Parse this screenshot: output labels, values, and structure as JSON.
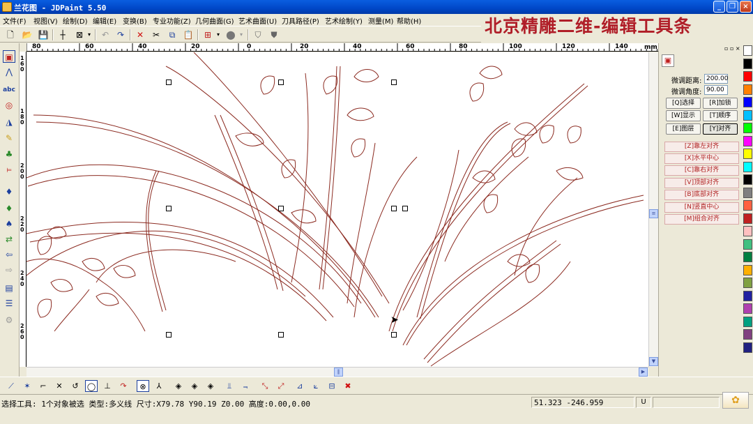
{
  "window": {
    "title": "兰花图 - JDPaint 5.50",
    "buttons": [
      "_",
      "❐",
      "×"
    ]
  },
  "banner": "北京精雕二维-编辑工具条",
  "menu": [
    "文件(F)",
    "视图(V)",
    "绘制(D)",
    "编辑(E)",
    "变换(B)",
    "专业功能(Z)",
    "几何曲面(G)",
    "艺术曲面(U)",
    "刀具路径(P)",
    "艺术绘制(Y)",
    "测量(M)",
    "帮助(H)"
  ],
  "ruler": {
    "unit": "mm",
    "h_ticks": [
      "80",
      "60",
      "40",
      "20",
      "0",
      "20",
      "40",
      "60",
      "80",
      "100",
      "120",
      "140"
    ],
    "v_ticks": [
      "160",
      "180",
      "200",
      "220",
      "240",
      "260"
    ]
  },
  "right_panel": {
    "distance_label": "微调距离:",
    "distance_value": "200.00",
    "angle_label": "微调角度:",
    "angle_value": "90.00",
    "buttons": [
      "[Q]选择",
      "[R]加锁",
      "[W]显示",
      "[T]顺序",
      "[E]图层",
      "[Y]对齐"
    ],
    "align_buttons": [
      "[Z]靠左对齐",
      "[X]水平中心",
      "[C]靠右对齐",
      "[V]顶部对齐",
      "[B]底部对齐",
      "[N]竖直中心",
      "[M]组合对齐"
    ]
  },
  "palette": [
    "#ffffff",
    "#000000",
    "#ff0000",
    "#ff8000",
    "#0000ff",
    "#00c0ff",
    "#00ff00",
    "#ff00ff",
    "#ffff00",
    "#00ffff",
    "#000000",
    "#808080",
    "#ff6040",
    "#c02020",
    "#ffc0c0",
    "#40c080",
    "#008040",
    "#ffb000",
    "#80a040",
    "#2020a0",
    "#b040b0",
    "#00a080",
    "#804080",
    "#202080"
  ],
  "status": {
    "text": "选择工具: 1个对象被选 类型:多义线 尺寸:X79.78 Y90.19 Z0.00 高度:0.00,0.00",
    "coords": "51.323 -246.959",
    "mode": "U"
  },
  "colors": {
    "drawing_stroke": "#8b2a20",
    "banner": "#b01e28",
    "titlebar": "#0a5ee0"
  },
  "icons": {
    "toolbar": [
      "new-file-icon",
      "open-folder-icon",
      "save-icon",
      "crosshair-icon",
      "box-select-icon",
      "dropdown-icon",
      "undo-icon",
      "redo-icon",
      "delete-icon",
      "cut-icon",
      "copy-icon",
      "paste-icon",
      "grid-icon",
      "fill-icon",
      "shade-icon",
      "shape-a-icon",
      "shape-b-icon"
    ],
    "left": [
      "select-tool-icon",
      "node-edit-icon",
      "text-tool-icon",
      "circle-tool-icon",
      "measure-tool-icon",
      "eraser-tool-icon",
      "bucket-tool-icon",
      "ruler-tool-icon",
      "bulb-blue-icon",
      "bulb-green-icon",
      "bulb-multi-icon",
      "transform-icon",
      "arrow-left-icon",
      "arrow-right-icon",
      "layers-icon",
      "text-lines-icon",
      "gear-disabled-icon"
    ],
    "bottom": [
      "line-tool-icon",
      "multi-line-icon",
      "corner-icon",
      "trim-icon",
      "arc-icon",
      "circle-node-icon",
      "perpendicular-icon",
      "tangent-icon",
      "join-icon",
      "extend-icon",
      "pattern-a-icon",
      "pattern-b-icon",
      "pattern-c-icon",
      "sweep-a-icon",
      "sweep-b-icon",
      "break-a-icon",
      "break-b-icon",
      "offset-a-icon",
      "offset-b-icon",
      "offset-c-icon",
      "cancel-icon"
    ]
  }
}
